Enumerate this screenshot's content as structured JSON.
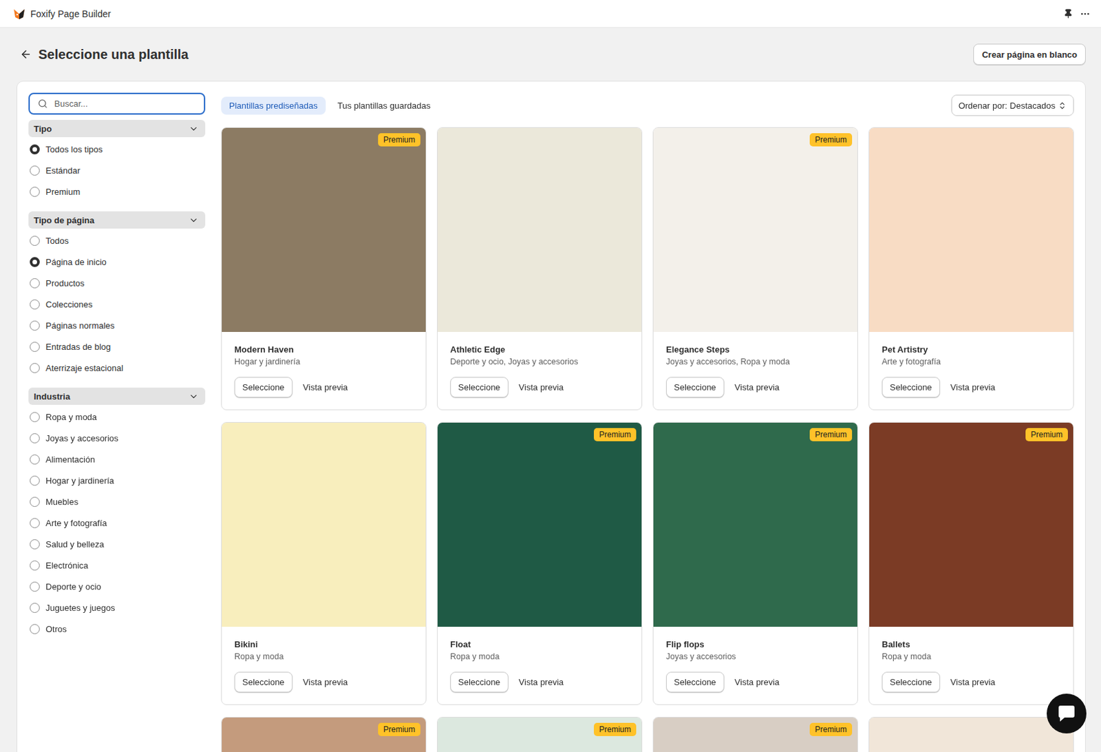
{
  "app": {
    "title": "Foxify Page Builder"
  },
  "header": {
    "title": "Seleccione una plantilla",
    "blank_button": "Crear página en blanco"
  },
  "search": {
    "placeholder": "Buscar...",
    "focused": true
  },
  "filters": [
    {
      "title": "Tipo",
      "expanded": true,
      "options": [
        {
          "label": "Todos los tipos",
          "selected": true
        },
        {
          "label": "Estándar",
          "selected": false
        },
        {
          "label": "Premium",
          "selected": false
        }
      ]
    },
    {
      "title": "Tipo de página",
      "expanded": true,
      "options": [
        {
          "label": "Todos",
          "selected": false
        },
        {
          "label": "Página de inicio",
          "selected": true
        },
        {
          "label": "Productos",
          "selected": false
        },
        {
          "label": "Colecciones",
          "selected": false
        },
        {
          "label": "Páginas normales",
          "selected": false
        },
        {
          "label": "Entradas de blog",
          "selected": false
        },
        {
          "label": "Aterrizaje estacional",
          "selected": false
        }
      ]
    },
    {
      "title": "Industria",
      "expanded": true,
      "options": [
        {
          "label": "Ropa y moda",
          "selected": false
        },
        {
          "label": "Joyas y accesorios",
          "selected": false
        },
        {
          "label": "Alimentación",
          "selected": false
        },
        {
          "label": "Hogar y jardinería",
          "selected": false
        },
        {
          "label": "Muebles",
          "selected": false
        },
        {
          "label": "Arte y fotografía",
          "selected": false
        },
        {
          "label": "Salud y belleza",
          "selected": false
        },
        {
          "label": "Electrónica",
          "selected": false
        },
        {
          "label": "Deporte y ocio",
          "selected": false
        },
        {
          "label": "Juguetes y juegos",
          "selected": false
        },
        {
          "label": "Otros",
          "selected": false
        }
      ]
    }
  ],
  "tabs": [
    {
      "label": "Plantillas prediseñadas",
      "selected": true
    },
    {
      "label": "Tus plantillas guardadas",
      "selected": false
    }
  ],
  "sort": {
    "label": "Ordenar por:",
    "value": "Destacados"
  },
  "premium_badge": "Premium",
  "card_actions": {
    "select": "Seleccione",
    "preview": "Vista previa"
  },
  "templates": [
    {
      "name": "Modern Haven",
      "industry": "Hogar y jardinería",
      "premium": true
    },
    {
      "name": "Athletic Edge",
      "industry": "Deporte y ocio, Joyas y accesorios",
      "premium": false
    },
    {
      "name": "Elegance Steps",
      "industry": "Joyas y accesorios, Ropa y moda",
      "premium": true
    },
    {
      "name": "Pet Artistry",
      "industry": "Arte y fotografía",
      "premium": false
    },
    {
      "name": "Bikini",
      "industry": "Ropa y moda",
      "premium": false
    },
    {
      "name": "Float",
      "industry": "Ropa y moda",
      "premium": true
    },
    {
      "name": "Flip flops",
      "industry": "Joyas y accesorios",
      "premium": true
    },
    {
      "name": "Ballets",
      "industry": "Ropa y moda",
      "premium": true
    }
  ],
  "more_templates": [
    {
      "premium": true
    },
    {
      "premium": true
    },
    {
      "premium": true
    },
    {
      "premium": false
    }
  ]
}
